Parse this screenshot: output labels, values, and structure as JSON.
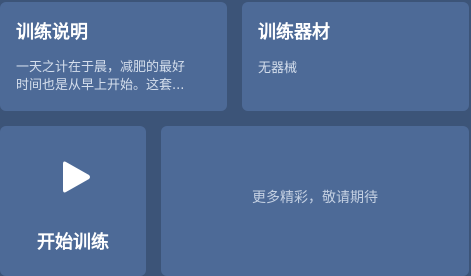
{
  "intro_card": {
    "title": "训练说明",
    "description_line1": "一天之计在于晨，减肥的最好",
    "description_line2": "时间也是从早上开始。这套..."
  },
  "equipment_card": {
    "title": "训练器材",
    "description": "无器械"
  },
  "start_card": {
    "icon": "play-icon",
    "label": "开始训练"
  },
  "more_card": {
    "text": "更多精彩，敬请期待"
  },
  "colors": {
    "background": "#3c5478",
    "card": "#4d6a97",
    "title_text": "#ffffff",
    "desc_text": "#d4deec"
  }
}
